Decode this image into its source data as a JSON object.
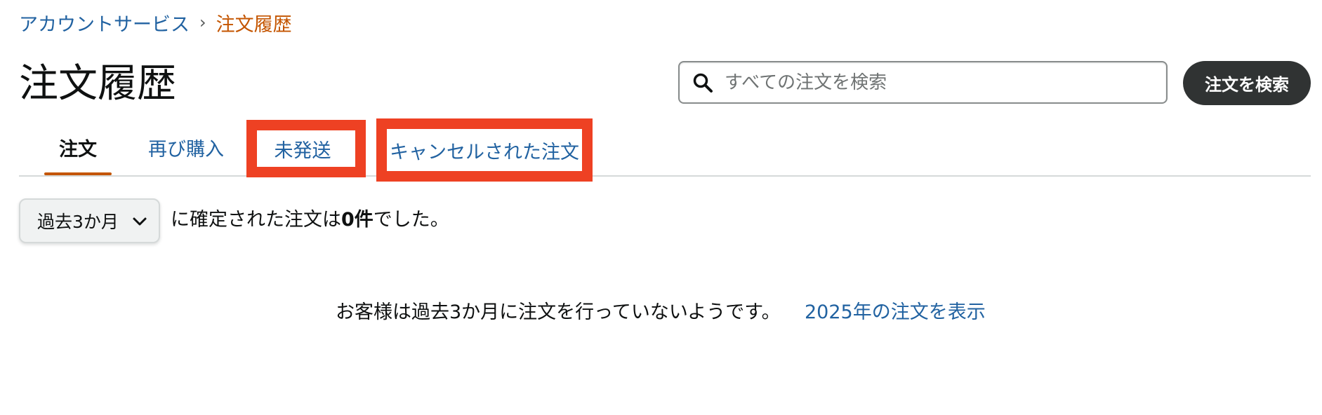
{
  "breadcrumb": {
    "parent": "アカウントサービス",
    "separator": "›",
    "current": "注文履歴"
  },
  "page_title": "注文履歴",
  "search": {
    "placeholder": "すべての注文を検索",
    "value": "",
    "button_label": "注文を検索",
    "icon": "search-icon"
  },
  "tabs": [
    {
      "label": "注文",
      "selected": true
    },
    {
      "label": "再び購入",
      "selected": false
    },
    {
      "label": "未発送",
      "selected": false,
      "highlighted": true
    },
    {
      "label": "キャンセルされた注文",
      "selected": false,
      "highlighted": true
    }
  ],
  "filter": {
    "range_label": "過去3か月",
    "summary_prefix": "に確定された注文は",
    "summary_count": "0件",
    "summary_suffix": "でした。"
  },
  "empty_state": {
    "message": "お客様は過去3か月に注文を行っていないようです。",
    "link_label": "2025年の注文を表示"
  },
  "colors": {
    "link": "#2162a1",
    "breadcrumb_current": "#c45500",
    "tab_underline": "#c45500",
    "highlight_box": "#ee4123",
    "search_button_bg": "#303333"
  }
}
